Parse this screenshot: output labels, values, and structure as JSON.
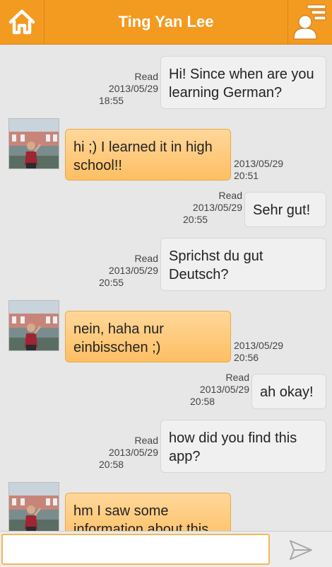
{
  "header": {
    "title": "Ting Yan Lee",
    "home_icon": "home-icon",
    "profile_icon": "contact-list-icon",
    "color": "#f39a21"
  },
  "messages": [
    {
      "direction": "out",
      "status": "Read",
      "date": "2013/05/29",
      "time": "18:55",
      "text": "Hi! Since when are you learning German?"
    },
    {
      "direction": "in",
      "date": "2013/05/29",
      "time": "20:51",
      "text": "hi ;) I learned it in high school!!"
    },
    {
      "direction": "out",
      "status": "Read",
      "date": "2013/05/29",
      "time": "20:55",
      "text": "Sehr gut!"
    },
    {
      "direction": "out",
      "status": "Read",
      "date": "2013/05/29",
      "time": "20:55",
      "text": "Sprichst du gut Deutsch?"
    },
    {
      "direction": "in",
      "date": "2013/05/29",
      "time": "20:56",
      "text": "nein, haha nur einbisschen ;)"
    },
    {
      "direction": "out",
      "status": "Read",
      "date": "2013/05/29",
      "time": "20:58",
      "text": "ah okay!"
    },
    {
      "direction": "out",
      "status": "Read",
      "date": "2013/05/29",
      "time": "20:58",
      "text": "how did you find this app?"
    },
    {
      "direction": "in",
      "date": "",
      "time": "",
      "text": "hm I saw some information about this"
    }
  ],
  "composer": {
    "placeholder": "",
    "send_icon": "send-icon"
  }
}
